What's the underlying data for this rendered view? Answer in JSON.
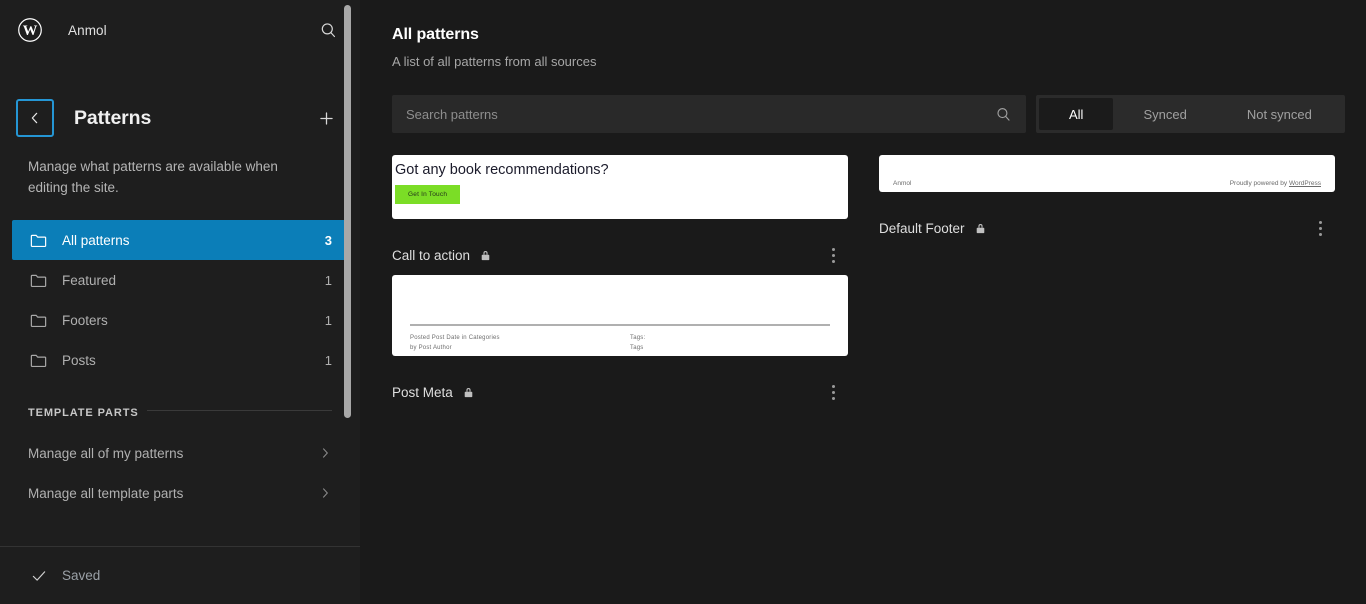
{
  "sidebar": {
    "logo_icon": "wordpress-logo-icon",
    "site_title": "Anmol",
    "search_icon": "search-icon",
    "back_icon": "chevron-left-icon",
    "panel_title": "Patterns",
    "add_icon": "plus-icon",
    "description": "Manage what patterns are available when editing the site.",
    "nav_items": [
      {
        "label": "All patterns",
        "count": "3",
        "icon": "folder-icon",
        "selected": true
      },
      {
        "label": "Featured",
        "count": "1",
        "icon": "folder-icon",
        "selected": false
      },
      {
        "label": "Footers",
        "count": "1",
        "icon": "folder-icon",
        "selected": false
      },
      {
        "label": "Posts",
        "count": "1",
        "icon": "folder-icon",
        "selected": false
      }
    ],
    "section_label": "TEMPLATE PARTS",
    "links": [
      {
        "label": "Manage all of my patterns",
        "icon": "chevron-right-icon"
      },
      {
        "label": "Manage all template parts",
        "icon": "chevron-right-icon"
      }
    ],
    "footer": {
      "status": "Saved",
      "icon": "check-icon"
    }
  },
  "main": {
    "title": "All patterns",
    "subtitle": "A list of all patterns from all sources",
    "search": {
      "placeholder": "Search patterns",
      "value": "",
      "icon": "search-icon"
    },
    "filters": [
      {
        "label": "All",
        "active": true
      },
      {
        "label": "Synced",
        "active": false
      },
      {
        "label": "Not synced",
        "active": false
      }
    ],
    "cards": [
      {
        "name": "Call to action",
        "lock_icon": "lock-icon",
        "menu_icon": "ellipsis-vertical-icon",
        "preview": {
          "heading": "Got any book recommendations?",
          "button_label": "Get In Touch",
          "button_color": "#7bdd26"
        }
      },
      {
        "name": "Default Footer",
        "lock_icon": "lock-icon",
        "menu_icon": "ellipsis-vertical-icon",
        "preview": {
          "left_text": "Anmol",
          "right_text_prefix": "Proudly powered by ",
          "right_text_link": "WordPress"
        }
      },
      {
        "name": "Post Meta",
        "lock_icon": "lock-icon",
        "menu_icon": "ellipsis-vertical-icon",
        "preview": {
          "line1": "Posted  Post Date  in  Categories",
          "line2": "by  Post Author",
          "line3": "Tags:",
          "line4": "Tags"
        }
      }
    ]
  },
  "colors": {
    "accent": "#0b7eb8",
    "sidebar_bg": "#1e1e1e",
    "main_bg": "#1a1a1a",
    "focus_outline": "#2596d4"
  }
}
